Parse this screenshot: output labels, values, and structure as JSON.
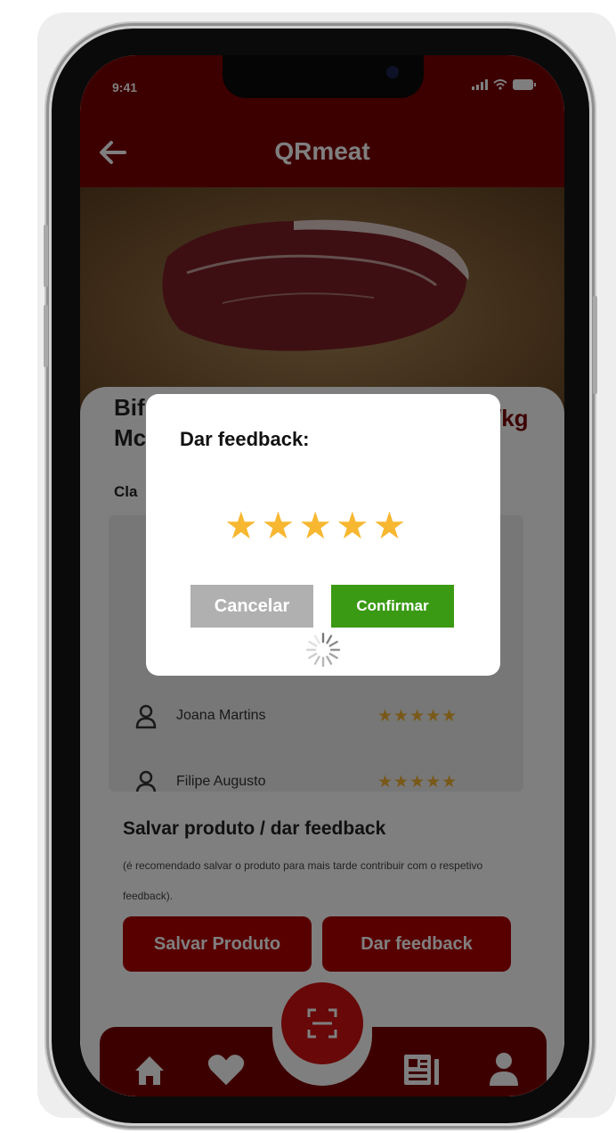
{
  "status_bar": {
    "time": "9:41"
  },
  "header": {
    "title": "QRmeat",
    "back_icon": "arrow-left-icon"
  },
  "product": {
    "name_line1": "Bif",
    "name_line2": "Mc",
    "name_right": "/kg",
    "classification_label": "Cla"
  },
  "reviews": [
    {
      "name": "Joana Martins",
      "stars": "★★★★★"
    },
    {
      "name": "Filipe Augusto",
      "stars": "★★★★★"
    }
  ],
  "save_section": {
    "title": "Salvar produto / dar feedback",
    "note": "(é recomendado salvar o produto para mais tarde contribuir com o respetivo feedback)."
  },
  "buttons": {
    "save": "Salvar Produto",
    "feedback": "Dar feedback"
  },
  "dialog": {
    "title": "Dar feedback:",
    "rating": 5,
    "stars": [
      "★",
      "★",
      "★",
      "★",
      "★"
    ],
    "cancel": "Cancelar",
    "confirm": "Confirmar"
  },
  "nav": {
    "items": [
      "home-icon",
      "heart-icon",
      "news-icon",
      "user-icon"
    ],
    "center": "qr-scan-icon"
  },
  "colors": {
    "primary": "#7a0000",
    "accent": "#b00000",
    "star": "#f7b731",
    "confirm": "#3a9a14",
    "cancel": "#b0b0b0"
  }
}
